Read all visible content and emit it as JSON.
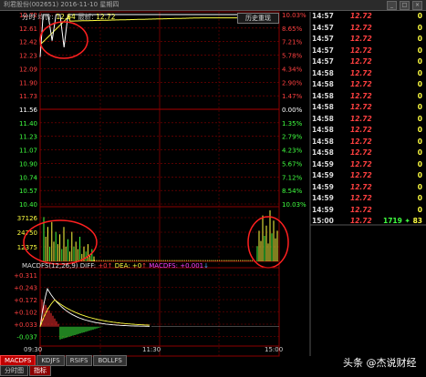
{
  "window": {
    "title": "利君股份(002651) 2016-11-10 星期四"
  },
  "header": {
    "label_line": "分时",
    "label_price": "均价:",
    "avg_price": "12.64",
    "label_latest": "最新:",
    "latest_price": "12.72"
  },
  "history_button": "历史重现",
  "price_axis": {
    "left_labels": [
      "12.72",
      "12.61",
      "12.42",
      "12.23",
      "12.09",
      "11.90",
      "11.73",
      "11.56",
      "11.40",
      "11.23",
      "11.07",
      "10.90",
      "10.74",
      "10.57",
      "10.40"
    ],
    "right_labels": [
      "10.03%",
      "8.65%",
      "7.21%",
      "5.78%",
      "4.34%",
      "2.90%",
      "1.47%",
      "0.00%",
      "1.35%",
      "2.79%",
      "4.23%",
      "5.67%",
      "7.12%",
      "8.54%",
      "10.03%"
    ],
    "base_label": "11.56"
  },
  "volume_axis": {
    "labels": [
      "37126",
      "24750",
      "12375"
    ]
  },
  "macd": {
    "header_name": "MACDFS(12,26,9)",
    "diff_label": "DIFF:",
    "diff_value": "+0",
    "dea_label": "DEA:",
    "dea_value": "+0",
    "macd_label": "MACDFS:",
    "macd_value": "+0.001",
    "axis_labels": [
      "+0.311",
      "+0.243",
      "+0.172",
      "+0.102",
      "+0.033",
      "-0.037"
    ]
  },
  "time_axis": {
    "start": "09:30",
    "mid": "11:30",
    "end": "15:00"
  },
  "tabs": [
    "MACDFS",
    "KDJFS",
    "RSIFS",
    "BOLLFS"
  ],
  "tabs2": [
    "分时图",
    "指标"
  ],
  "trades": [
    {
      "time": "14:57",
      "price": "12.72",
      "value": "0"
    },
    {
      "time": "14:57",
      "price": "12.72",
      "value": "0"
    },
    {
      "time": "14:57",
      "price": "12.72",
      "value": "0"
    },
    {
      "time": "14:57",
      "price": "12.72",
      "value": "0"
    },
    {
      "time": "14:57",
      "price": "12.72",
      "value": "0"
    },
    {
      "time": "14:58",
      "price": "12.72",
      "value": "0"
    },
    {
      "time": "14:58",
      "price": "12.72",
      "value": "0"
    },
    {
      "time": "14:58",
      "price": "12.72",
      "value": "0"
    },
    {
      "time": "14:58",
      "price": "12.72",
      "value": "0"
    },
    {
      "time": "14:58",
      "price": "12.72",
      "value": "0"
    },
    {
      "time": "14:58",
      "price": "12.72",
      "value": "0"
    },
    {
      "time": "14:58",
      "price": "12.72",
      "value": "0"
    },
    {
      "time": "14:58",
      "price": "12.72",
      "value": "0"
    },
    {
      "time": "14:59",
      "price": "12.72",
      "value": "0"
    },
    {
      "time": "14:59",
      "price": "12.72",
      "value": "0"
    },
    {
      "time": "14:59",
      "price": "12.72",
      "value": "0"
    },
    {
      "time": "14:59",
      "price": "12.72",
      "value": "0"
    },
    {
      "time": "14:59",
      "price": "12.72",
      "value": "0"
    }
  ],
  "final_trade": {
    "time": "15:00",
    "price": "12.72",
    "volume": "1719",
    "value": "83"
  },
  "watermark": "头条 @杰说财经",
  "colors": {
    "up": "#ff4040",
    "down": "#40ff40",
    "grid": "#8b0000",
    "avg": "#ffff40",
    "price": "#ffffff"
  }
}
